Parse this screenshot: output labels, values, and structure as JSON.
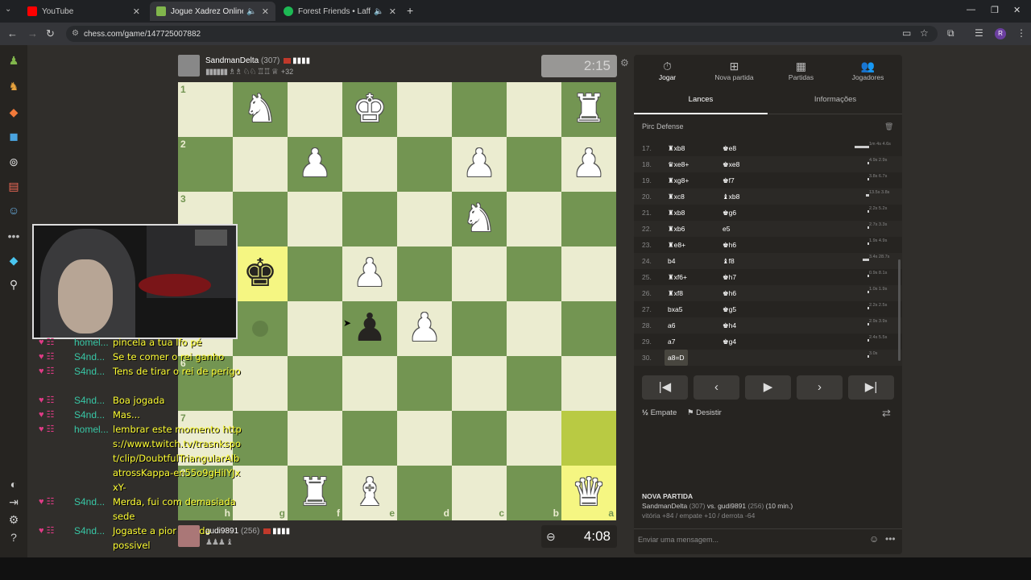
{
  "browser": {
    "tabs": [
      {
        "title": "YouTube",
        "icon": "youtube-icon",
        "color": "#ff0000"
      },
      {
        "title": "Jogue Xadrez Online de GRÁTIS",
        "icon": "chess-icon",
        "color": "#81b64c"
      },
      {
        "title": "Forest Friends • Laffey, softy",
        "icon": "spotify-icon",
        "color": "#1db954"
      }
    ],
    "url": "chess.com/game/147725007882"
  },
  "top_player": {
    "name": "SandmanDelta",
    "rating": "(307)",
    "captured": "▮▮▮▮▮▮ ♗♗ ♘♘ ♖♖ ♕",
    "advantage": "+32",
    "clock": "2:15"
  },
  "bottom_player": {
    "name": "gudi9891",
    "rating": "(256)",
    "captured": "♟♟♟ ♝",
    "clock": "4:08"
  },
  "board": {
    "light_color": "#ebecd0",
    "dark_color": "#739552",
    "ranks": [
      "1",
      "2",
      "3",
      "4",
      "5",
      "6",
      "7",
      "8"
    ],
    "files": [
      "h",
      "g",
      "f",
      "e",
      "d",
      "c",
      "b",
      "a"
    ],
    "rows": [
      [
        "",
        "wN",
        "",
        "wK",
        "",
        "",
        "",
        "wR"
      ],
      [
        "",
        "",
        "wP",
        "",
        "",
        "wP",
        "",
        "wP"
      ],
      [
        "",
        "",
        "",
        "",
        "",
        "wN",
        "",
        ""
      ],
      [
        "",
        "bK",
        "",
        "wP",
        "",
        "",
        "",
        ""
      ],
      [
        "",
        "",
        "",
        "bP",
        "wP",
        "",
        "",
        ""
      ],
      [
        "",
        "",
        "",
        "",
        "",
        "",
        "",
        ""
      ],
      [
        "",
        "",
        "",
        "",
        "",
        "",
        "",
        ""
      ],
      [
        "",
        "",
        "wR",
        "wB",
        "",
        "",
        "",
        "wQ"
      ]
    ],
    "highlights": [
      "3,1",
      "6,7",
      "7,7"
    ],
    "hints": [
      "4,1"
    ]
  },
  "chat_messages": [
    {
      "user": "homel...",
      "msg": "pincela a tua lfo pé"
    },
    {
      "user": "S4nd...",
      "msg": "Se te comer o rei ganho"
    },
    {
      "user": "S4nd...",
      "msg": "Tens de tirar o rei de perigo"
    },
    {
      "user": "S4nd...",
      "msg": "Boa jogada"
    },
    {
      "user": "S4nd...",
      "msg": "Mas..."
    },
    {
      "user": "homel...",
      "msg": "lembrar este momento https://www.twitch.tv/trasnkspot/clip/DoubtfulTriangularAlbatrossKappa-en55o9gHiIYJxxY-"
    },
    {
      "user": "S4nd...",
      "msg": "Merda, fui com demasiada sede"
    },
    {
      "user": "S4nd...",
      "msg": "Jogaste a pior jogada possivel"
    }
  ],
  "panel": {
    "nav": [
      {
        "label": "Jogar",
        "icon": "clock-icon"
      },
      {
        "label": "Nova partida",
        "icon": "plus-icon"
      },
      {
        "label": "Partidas",
        "icon": "board-icon"
      },
      {
        "label": "Jogadores",
        "icon": "users-icon"
      }
    ],
    "subtabs": [
      "Lances",
      "Informações"
    ],
    "opening": "Pirc Defense",
    "moves": [
      {
        "n": "17.",
        "w": "♜xb8",
        "b": "♚e8",
        "tw": "",
        "tb": "1m 4s 4.6s",
        "bar": 0.9
      },
      {
        "n": "18.",
        "w": "♛xe8+",
        "b": "♚xe8",
        "tw": "",
        "tb": "4.9s 2.9s",
        "bar": 0.1
      },
      {
        "n": "19.",
        "w": "♜xg8+",
        "b": "♚f7",
        "tw": "",
        "tb": "3.8s 6.7s",
        "bar": 0.1
      },
      {
        "n": "20.",
        "w": "♜xc8",
        "b": "♝xb8",
        "tw": "",
        "tb": "13.5s 3.8s",
        "bar": 0.2
      },
      {
        "n": "21.",
        "w": "♜xb8",
        "b": "♚g6",
        "tw": "",
        "tb": "2.2s 5.2s",
        "bar": 0.1
      },
      {
        "n": "22.",
        "w": "♜xb6",
        "b": "e5",
        "tw": "",
        "tb": "2.7s 3.3s",
        "bar": 0.1
      },
      {
        "n": "23.",
        "w": "♜e8+",
        "b": "♚h6",
        "tw": "",
        "tb": "1.9s 4.9s",
        "bar": 0.1
      },
      {
        "n": "24.",
        "w": "b4",
        "b": "♝f8",
        "tw": "",
        "tb": "3.4s 28.7s",
        "bar": 0.4
      },
      {
        "n": "25.",
        "w": "♜xf6+",
        "b": "♚h7",
        "tw": "",
        "tb": "0.9s 8.1s",
        "bar": 0.1
      },
      {
        "n": "26.",
        "w": "♜xf8",
        "b": "♚h6",
        "tw": "",
        "tb": "1.0s 1.9s",
        "bar": 0.1
      },
      {
        "n": "27.",
        "w": "bxa5",
        "b": "♚g5",
        "tw": "",
        "tb": "2.2s 2.5s",
        "bar": 0.1
      },
      {
        "n": "28.",
        "w": "a6",
        "b": "♚h4",
        "tw": "",
        "tb": "2.9s 3.9s",
        "bar": 0.1
      },
      {
        "n": "29.",
        "w": "a7",
        "b": "♚g4",
        "tw": "",
        "tb": "2.4s 5.5s",
        "bar": 0.1
      },
      {
        "n": "30.",
        "w": "a8=D",
        "b": "",
        "tw": "",
        "tb": "3.0s",
        "bar": 0.1
      }
    ],
    "draw_label": "Empate",
    "resign_label": "Desistir",
    "new_game": {
      "heading": "NOVA PARTIDA",
      "players": "SandmanDelta",
      "r1": "(307)",
      "vs": "vs.",
      "p2": "gudi9891",
      "r2": "(256)",
      "mode": "(10 min.)",
      "stats": "vitória +84 / empate +10 / derrota -64"
    },
    "chat_placeholder": "Enviar uma mensagem..."
  }
}
